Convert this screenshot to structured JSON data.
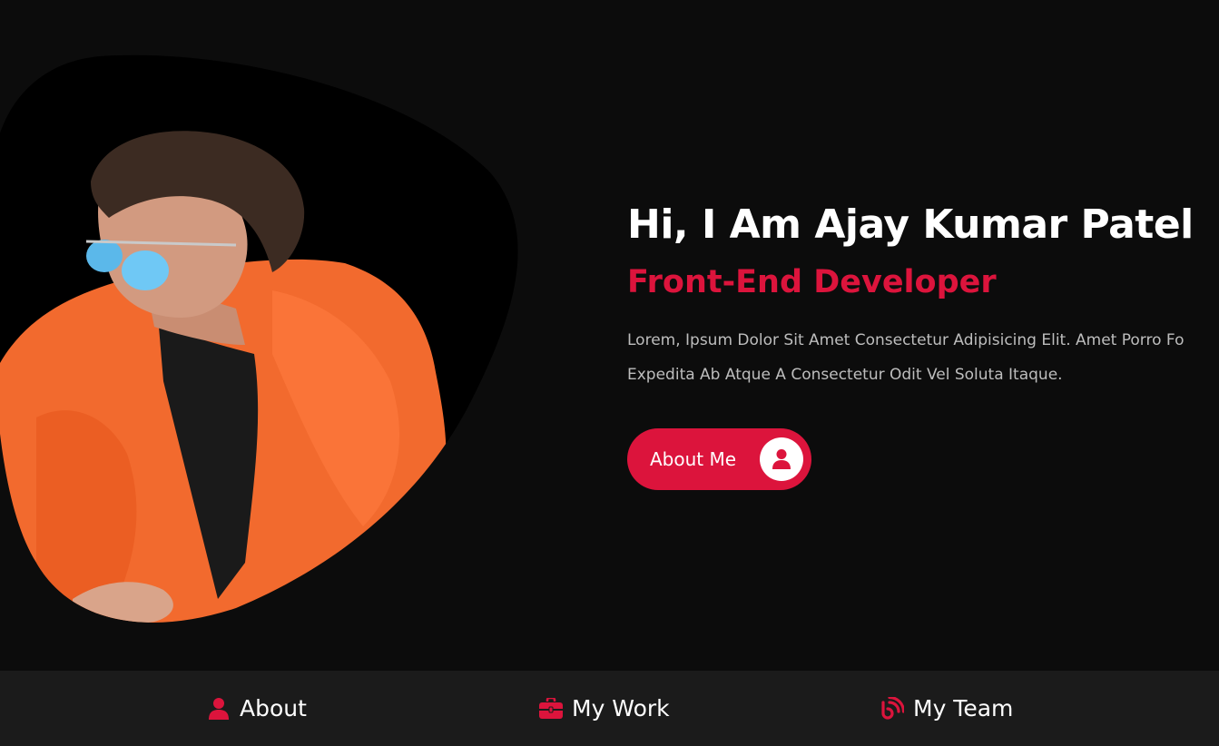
{
  "hero": {
    "title": "Hi, I Am Ajay Kumar Patel",
    "role": "Front-End Developer",
    "description_line1": "Lorem, Ipsum Dolor Sit Amet Consectetur Adipisicing Elit. Amet Porro Fo",
    "description_line2": "Expedita Ab Atque A Consectetur Odit Vel Soluta Itaque.",
    "button_label": "About Me",
    "button_icon": "user-icon"
  },
  "nav": {
    "items": [
      {
        "label": "About",
        "icon": "user-icon"
      },
      {
        "label": "My Work",
        "icon": "briefcase-icon"
      },
      {
        "label": "My Team",
        "icon": "broadcast-icon"
      }
    ]
  },
  "colors": {
    "background": "#0c0c0c",
    "accent": "#dc143c",
    "nav_background": "#1b1b1b",
    "text": "#ffffff"
  }
}
